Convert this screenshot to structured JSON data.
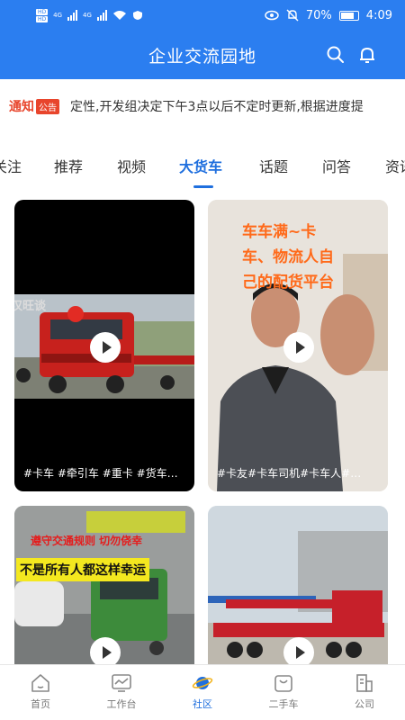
{
  "status": {
    "signal_left": "4G",
    "signal_right": "4G",
    "battery": "70%",
    "time": "4:09",
    "hd1": "HD",
    "hd2": "HD"
  },
  "header": {
    "title": "企业交流园地"
  },
  "notice": {
    "tag": "通知",
    "badge": "公告",
    "text": "定性,开发组决定下午3点以后不定时更新,根据进度提"
  },
  "tabs": [
    "关注",
    "推荐",
    "视频",
    "大货车",
    "话题",
    "问答",
    "资讯"
  ],
  "active_tab": "大货车",
  "cards": [
    {
      "caption": "#卡车 #牵引车 #重卡 #货车…",
      "overlay": "汉旺谈"
    },
    {
      "caption": "#卡友#卡车司机#卡车人#…",
      "overlay_lines": [
        "车车满~卡",
        "车、物流人自",
        "己的配货平台"
      ]
    },
    {
      "overlay_lines": [
        "遵守交通规则 切勿侥幸",
        "不是所有人都这样幸运"
      ]
    },
    {}
  ],
  "nav": [
    {
      "label": "首页",
      "icon": "home-icon"
    },
    {
      "label": "工作台",
      "icon": "workbench-icon"
    },
    {
      "label": "社区",
      "icon": "community-planet-icon"
    },
    {
      "label": "二手车",
      "icon": "used-car-icon"
    },
    {
      "label": "公司",
      "icon": "company-icon"
    }
  ],
  "colors": {
    "primary": "#2b7ef0",
    "active": "#1f6fde",
    "notice": "#e8452c"
  }
}
